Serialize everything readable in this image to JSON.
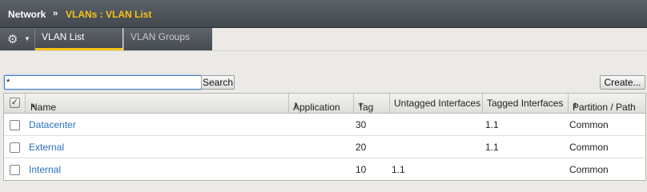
{
  "breadcrumb": {
    "section": "Network",
    "separator": "››",
    "page": "VLANs : VLAN List"
  },
  "tabs": {
    "gear_icon": "gear-icon",
    "items": [
      {
        "label": "VLAN List",
        "active": true
      },
      {
        "label": "VLAN Groups",
        "active": false
      }
    ]
  },
  "search": {
    "value": "*",
    "button_label": "Search"
  },
  "create_button_label": "Create...",
  "table": {
    "columns": {
      "name": "Name",
      "application": "Application",
      "tag": "Tag",
      "untagged": "Untagged Interfaces",
      "tagged": "Tagged Interfaces",
      "partition": "Partition / Path"
    },
    "rows": [
      {
        "name": "Datacenter",
        "application": "",
        "tag": "30",
        "untagged": "",
        "tagged": "1.1",
        "partition": "Common"
      },
      {
        "name": "External",
        "application": "",
        "tag": "20",
        "untagged": "",
        "tagged": "1.1",
        "partition": "Common"
      },
      {
        "name": "Internal",
        "application": "",
        "tag": "10",
        "untagged": "1.1",
        "tagged": "",
        "partition": "Common"
      }
    ]
  },
  "colors": {
    "accent": "#f7c318",
    "link": "#2a6fbc",
    "header_bar": "#4b5056"
  }
}
